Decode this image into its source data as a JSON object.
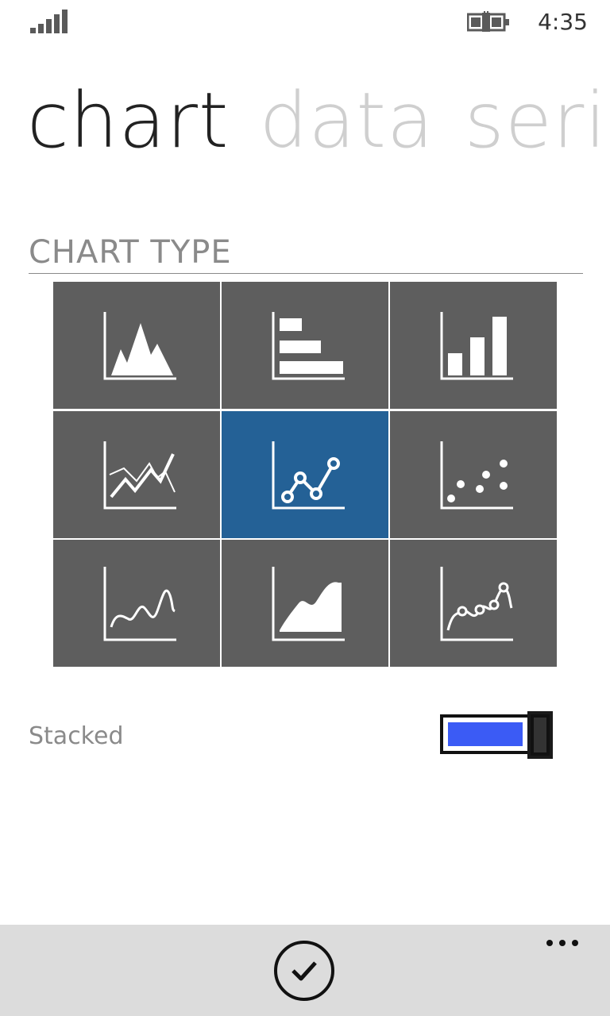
{
  "status_bar": {
    "time": "4:35",
    "icons": {
      "signal": "signal-strength-icon",
      "battery": "battery-charging-icon"
    }
  },
  "pivot": {
    "items": [
      {
        "label": "chart",
        "active": true
      },
      {
        "label": "data",
        "active": false
      },
      {
        "label": "series",
        "active": false
      }
    ]
  },
  "chart_type_section": {
    "title": "CHART TYPE",
    "selected_index": 4,
    "types": [
      {
        "icon": "area-peaks-chart-icon"
      },
      {
        "icon": "horizontal-bar-chart-icon"
      },
      {
        "icon": "vertical-bar-chart-icon"
      },
      {
        "icon": "multi-line-chart-icon"
      },
      {
        "icon": "line-markers-chart-icon"
      },
      {
        "icon": "scatter-chart-icon"
      },
      {
        "icon": "spline-chart-icon"
      },
      {
        "icon": "smooth-area-chart-icon"
      },
      {
        "icon": "spline-markers-chart-icon"
      }
    ]
  },
  "stacked": {
    "label": "Stacked",
    "on": true
  },
  "app_bar": {
    "icons": {
      "confirm": "checkmark-icon",
      "more": "ellipsis-icon"
    }
  },
  "colors": {
    "tile": "#5e5e5e",
    "tile_selected": "#246196",
    "toggle_fill": "#3b5bf5",
    "app_bar": "#dcdcdc"
  }
}
